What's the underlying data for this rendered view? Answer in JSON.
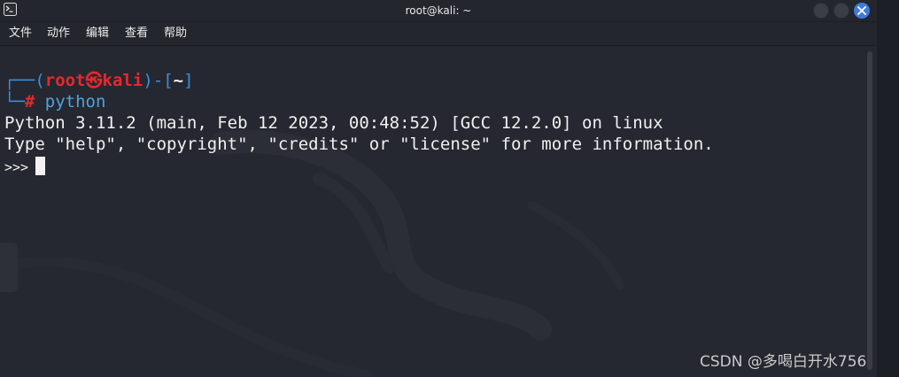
{
  "window": {
    "title": "root@kali: ~",
    "controls": [
      "minimize",
      "maximize",
      "close"
    ]
  },
  "menu": [
    "文件",
    "动作",
    "编辑",
    "查看",
    "帮助"
  ],
  "terminal": {
    "prompt": {
      "open_bracket": "┌──(",
      "user": "root",
      "skull": "㉿",
      "host": "kali",
      "mid": ")-[",
      "path": "~",
      "close_bracket": "]",
      "second_corner": "└─",
      "hash": "#",
      "command": "python"
    },
    "output": [
      "Python 3.11.2 (main, Feb 12 2023, 00:48:52) [GCC 12.2.0] on linux",
      "Type \"help\", \"copyright\", \"credits\" or \"license\" for more information."
    ],
    "repl_prompt": ">>>"
  },
  "watermark": "CSDN @多喝白开水756",
  "colors": {
    "background": "#252830",
    "prompt_blue": "#3b8fe0",
    "prompt_red": "#e8272e",
    "close_button": "#3f7bd9"
  }
}
